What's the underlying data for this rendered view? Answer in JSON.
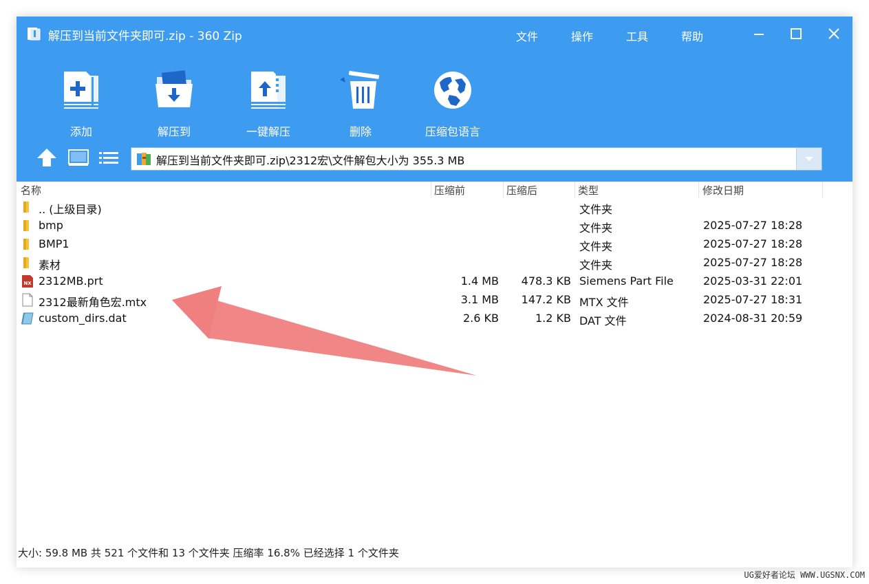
{
  "window": {
    "title": "解压到当前文件夹即可.zip - 360 Zip",
    "menu": [
      "文件",
      "操作",
      "工具",
      "帮助"
    ]
  },
  "toolbar": {
    "add": "添加",
    "extract_to": "解压到",
    "one_click_extract": "一键解压",
    "delete": "删除",
    "archive_language": "压缩包语言"
  },
  "address": {
    "path": "解压到当前文件夹即可.zip\\2312宏\\文件解包大小为 355.3 MB"
  },
  "columns": {
    "name": "名称",
    "before": "压缩前",
    "after": "压缩后",
    "type": "类型",
    "modified": "修改日期"
  },
  "rows": [
    {
      "name": ".. (上级目录)",
      "before": "",
      "after": "",
      "type": "文件夹",
      "modified": "",
      "icon": "folder-icon"
    },
    {
      "name": "bmp",
      "before": "",
      "after": "",
      "type": "文件夹",
      "modified": "2025-07-27 18:28",
      "icon": "folder-icon"
    },
    {
      "name": "BMP1",
      "before": "",
      "after": "",
      "type": "文件夹",
      "modified": "2025-07-27 18:28",
      "icon": "folder-icon"
    },
    {
      "name": "素材",
      "before": "",
      "after": "",
      "type": "文件夹",
      "modified": "2025-07-27 18:28",
      "icon": "folder-icon"
    },
    {
      "name": "2312MB.prt",
      "before": "1.4 MB",
      "after": "478.3 KB",
      "type": "Siemens Part File",
      "modified": "2025-03-31 22:01",
      "icon": "nx-file-icon",
      "nx_label": "NX"
    },
    {
      "name": "2312最新角色宏.mtx",
      "before": "3.1 MB",
      "after": "147.2 KB",
      "type": "MTX 文件",
      "modified": "2025-07-27 18:31",
      "icon": "document-icon"
    },
    {
      "name": "custom_dirs.dat",
      "before": "2.6 KB",
      "after": "1.2 KB",
      "type": "DAT 文件",
      "modified": "2024-08-31 20:59",
      "icon": "dat-file-icon"
    }
  ],
  "status": {
    "text": "大小: 59.8 MB 共 521 个文件和 13 个文件夹 压缩率 16.8% 已经选择 1 个文件夹"
  },
  "watermark": "UG爱好者论坛 WWW.UGSNX.COM",
  "colors": {
    "accent": "#3d9bf0",
    "arrow": "#f08080",
    "folder": "#f5c542"
  }
}
